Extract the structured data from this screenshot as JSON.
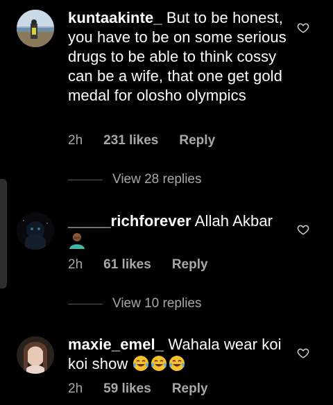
{
  "comments": [
    {
      "username": "kuntaakinte_",
      "text": "But to be honest, you have to be on some serious drugs to be able to think cossy can be a wife, that one get gold medal for olosho olympics",
      "time": "2h",
      "likes": "231 likes",
      "reply": "Reply",
      "view_replies": "View 28 replies"
    },
    {
      "username": "_____richforever",
      "text": "Allah Akbar",
      "time": "2h",
      "likes": "61 likes",
      "reply": "Reply",
      "view_replies": "View 10 replies"
    },
    {
      "username": "maxie_emel_",
      "text": "Wahala wear koi koi show",
      "time": "2h",
      "likes": "59 likes",
      "reply": "Reply"
    }
  ],
  "icons": {
    "like": "heart-outline-icon",
    "emoji_person": "person-facepalm-emoji",
    "emoji_laugh": "face-with-tears-of-joy-emoji"
  },
  "colors": {
    "background": "#000000",
    "text": "#ffffff",
    "secondary": "#a8a8a8"
  }
}
